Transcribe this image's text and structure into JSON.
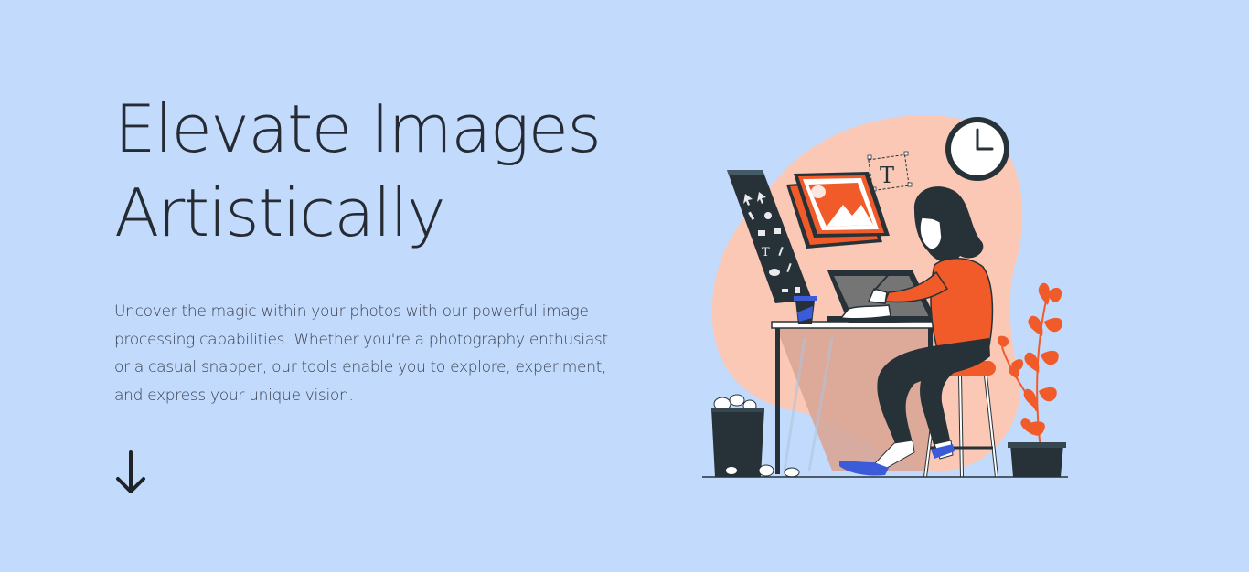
{
  "hero": {
    "title_line1": "Elevate Images",
    "title_line2": "Artistically",
    "description": "Uncover the magic within your photos with our powerful image processing capabilities. Whether you're a photography enthusiast or a casual snapper, our tools enable you to explore, experiment, and express your unique vision.",
    "scroll_icon": "arrow-down-icon"
  },
  "illustration": {
    "subject": "woman-drawing-on-tablet-illustration",
    "text_tool_glyph": "T"
  },
  "colors": {
    "background": "#c2dbfd",
    "accent": "#f15a29",
    "blob": "#fbc8b5",
    "dark": "#263238",
    "blue": "#3b5bd9"
  }
}
